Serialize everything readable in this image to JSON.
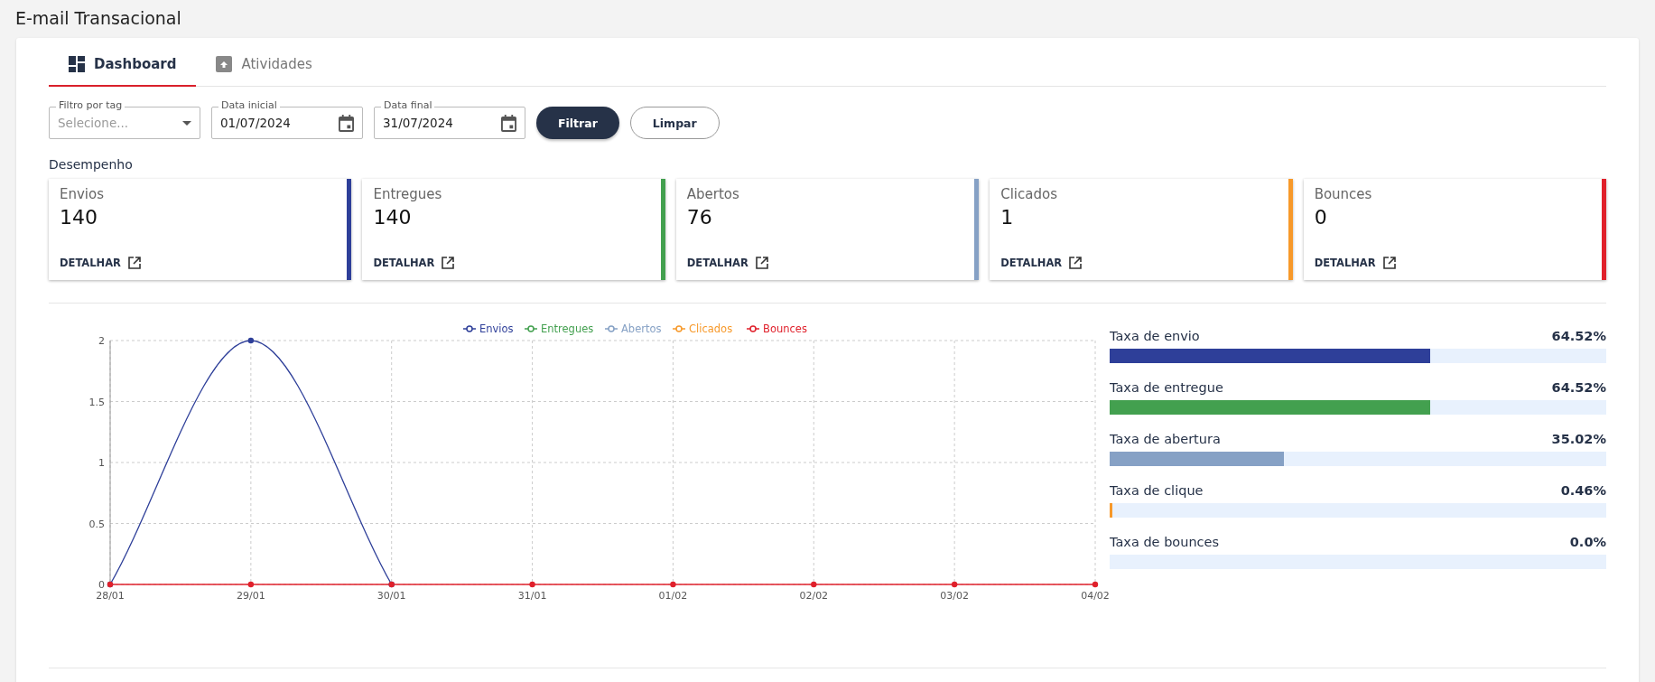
{
  "page_title": "E-mail Transacional",
  "tabs": [
    {
      "label": "Dashboard",
      "selected": true
    },
    {
      "label": "Atividades",
      "selected": false
    }
  ],
  "filters": {
    "tag": {
      "label": "Filtro por tag",
      "placeholder": "Selecione..."
    },
    "start_date": {
      "label": "Data inicial",
      "value": "01/07/2024"
    },
    "end_date": {
      "label": "Data final",
      "value": "31/07/2024"
    },
    "buttons": [
      {
        "label": "Filtrar",
        "kind": "primary"
      },
      {
        "label": "Limpar",
        "kind": "outline"
      }
    ]
  },
  "section_title": "Desempenho",
  "cards": [
    {
      "label": "Envios",
      "value": "140",
      "link": "DETALHAR",
      "color": "#2e3f99"
    },
    {
      "label": "Entregues",
      "value": "140",
      "link": "DETALHAR",
      "color": "#43a04f"
    },
    {
      "label": "Abertos",
      "value": "76",
      "link": "DETALHAR",
      "color": "#86a1c5"
    },
    {
      "label": "Clicados",
      "value": "1",
      "link": "DETALHAR",
      "color": "#f7992a"
    },
    {
      "label": "Bounces",
      "value": "0",
      "link": "DETALHAR",
      "color": "#e0202b"
    }
  ],
  "chart": {
    "chart_data": {
      "type": "line",
      "categories": [
        "28/01",
        "29/01",
        "30/01",
        "31/01",
        "01/02",
        "02/02",
        "03/02",
        "04/02"
      ],
      "ylim": [
        0,
        2
      ],
      "yticks": [
        0,
        0.5,
        1,
        1.5,
        2
      ],
      "grid": true,
      "legend": "top",
      "series": [
        {
          "name": "Envios",
          "color": "#2e3f99",
          "marker": "circle",
          "values": [
            0,
            2,
            0,
            null,
            null,
            null,
            null,
            null
          ]
        },
        {
          "name": "Entregues",
          "color": "#43a04f",
          "marker": "circle",
          "values": [
            null,
            null,
            null,
            null,
            null,
            null,
            null,
            null
          ]
        },
        {
          "name": "Abertos",
          "color": "#86a1c5",
          "marker": "circle",
          "values": [
            null,
            null,
            null,
            null,
            null,
            null,
            null,
            null
          ]
        },
        {
          "name": "Clicados",
          "color": "#f7992a",
          "marker": "circle",
          "values": [
            null,
            null,
            null,
            null,
            null,
            null,
            null,
            null
          ]
        },
        {
          "name": "Bounces",
          "color": "#e0202b",
          "marker": "circle",
          "values": [
            0,
            0,
            0,
            0,
            0,
            0,
            0,
            0
          ]
        }
      ]
    }
  },
  "rates": [
    {
      "label": "Taxa de envio",
      "value": "64.52%",
      "level": 0.6452,
      "color": "#2e3f99"
    },
    {
      "label": "Taxa de entregue",
      "value": "64.52%",
      "level": 0.6452,
      "color": "#43a04f"
    },
    {
      "label": "Taxa de abertura",
      "value": "35.02%",
      "level": 0.3502,
      "color": "#86a1c5"
    },
    {
      "label": "Taxa de clique",
      "value": "0.46%",
      "level": 0.0046,
      "color": "#f7992a"
    },
    {
      "label": "Taxa de bounces",
      "value": "0.0%"
    }
  ]
}
